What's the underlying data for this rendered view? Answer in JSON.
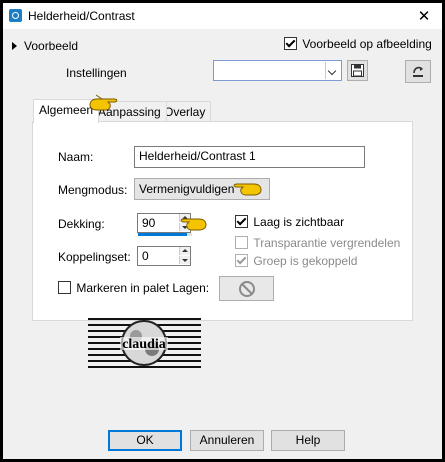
{
  "window": {
    "title": "Helderheid/Contrast",
    "close_glyph": "✕"
  },
  "preview": {
    "toggle_label": "Voorbeeld",
    "preview_on_image_label": "Voorbeeld op afbeelding",
    "preview_on_image_checked": true
  },
  "settings": {
    "label": "Instellingen",
    "value": ""
  },
  "tabs": [
    {
      "label": "Algemeen",
      "active": true
    },
    {
      "label": "Aanpassing",
      "active": false
    },
    {
      "label": "Overlay",
      "active": false
    }
  ],
  "general": {
    "name_label": "Naam:",
    "name_value": "Helderheid/Contrast 1",
    "blend_label": "Mengmodus:",
    "blend_value": "Vermenigvuldigen",
    "opacity_label": "Dekking:",
    "opacity_value": "90",
    "opacity_fraction": 0.9,
    "linkset_label": "Koppelingset:",
    "linkset_value": "0",
    "layer_visible_label": "Laag is zichtbaar",
    "layer_visible_checked": true,
    "lock_transparency_label": "Transparantie vergrendelen",
    "lock_transparency_checked": false,
    "group_linked_label": "Groep is gekoppeld",
    "group_linked_checked": true,
    "highlight_label": "Markeren in palet Lagen:",
    "highlight_checked": false
  },
  "watermark": {
    "text": "claudia"
  },
  "buttons": {
    "ok": "OK",
    "cancel": "Annuleren",
    "help": "Help"
  },
  "colors": {
    "accent": "#0078d7",
    "hand": "#f5c400"
  }
}
